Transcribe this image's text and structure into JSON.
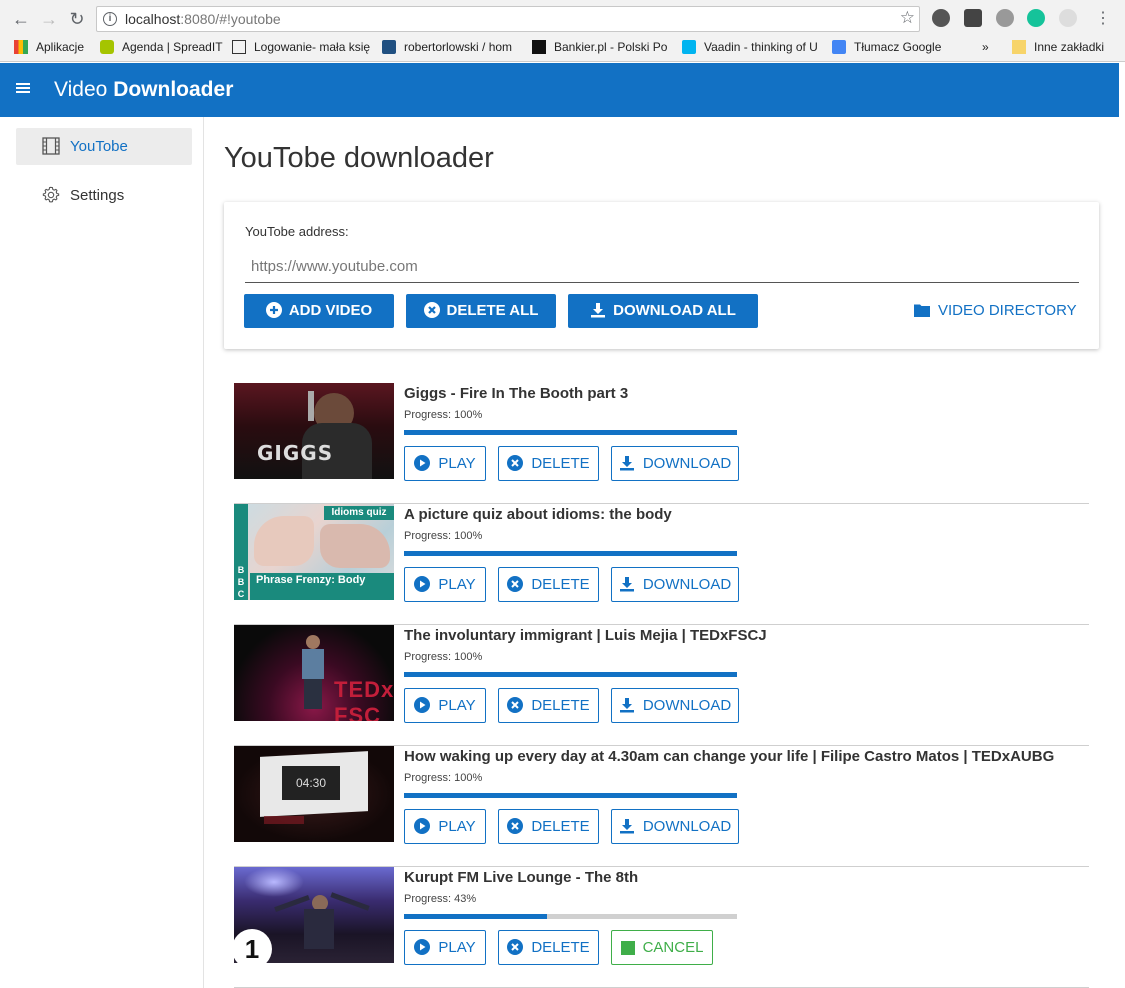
{
  "browser": {
    "url_host": "localhost",
    "url_path": ":8080/#!youtobe",
    "bookmarks": [
      {
        "label": "Aplikacje",
        "icon": "apps-grid-icon"
      },
      {
        "label": "Agenda | SpreadIT",
        "icon": "spreadit-icon"
      },
      {
        "label": "Logowanie- mała księ",
        "icon": "ifi-icon"
      },
      {
        "label": "robertorlowski / hom",
        "icon": "bitbucket-icon"
      },
      {
        "label": "Bankier.pl - Polski Po",
        "icon": "bankier-icon"
      },
      {
        "label": "Vaadin - thinking of U",
        "icon": "vaadin-icon"
      },
      {
        "label": "Tłumacz Google",
        "icon": "google-translate-icon"
      }
    ],
    "more_bookmarks": "»",
    "other_bookmarks": "Inne zakładki"
  },
  "app": {
    "title_light": "Video",
    "title_bold": "Downloader",
    "primary_color": "#1271c4"
  },
  "sidebar": {
    "items": [
      {
        "label": "YouTobe",
        "icon": "film-icon",
        "active": true
      },
      {
        "label": "Settings",
        "icon": "gear-icon",
        "active": false
      }
    ]
  },
  "main": {
    "title": "YouTobe downloader",
    "address_label": "YouTobe address:",
    "address_placeholder": "https://www.youtube.com",
    "add_video": "ADD VIDEO",
    "delete_all": "DELETE ALL",
    "download_all": "DOWNLOAD ALL",
    "video_directory": "VIDEO DIRECTORY"
  },
  "videos": [
    {
      "title": "Giggs - Fire In The Booth part 3",
      "progress_label": "Progress: 100%",
      "progress": 1.0,
      "play": "PLAY",
      "delete": "DELETE",
      "action": "DOWNLOAD",
      "action_type": "download",
      "thumb_text": "GIGGS"
    },
    {
      "title": "A picture quiz about idioms: the body",
      "progress_label": "Progress: 100%",
      "progress": 1.0,
      "play": "PLAY",
      "delete": "DELETE",
      "action": "DOWNLOAD",
      "action_type": "download",
      "thumb_text": "Phrase Frenzy: Body",
      "thumb_text2": "Idioms quiz",
      "thumb_text3": "BBC"
    },
    {
      "title": "The involuntary immigrant | Luis Mejia | TEDxFSCJ",
      "progress_label": "Progress: 100%",
      "progress": 1.0,
      "play": "PLAY",
      "delete": "DELETE",
      "action": "DOWNLOAD",
      "action_type": "download",
      "thumb_text": "TEDx FSC"
    },
    {
      "title": "How waking up every day at 4.30am can change your life | Filipe Castro Matos | TEDxAUBG",
      "progress_label": "Progress: 100%",
      "progress": 1.0,
      "play": "PLAY",
      "delete": "DELETE",
      "action": "DOWNLOAD",
      "action_type": "download",
      "thumb_text": "04:30"
    },
    {
      "title": "Kurupt FM Live Lounge - The 8th",
      "progress_label": "Progress: 43%",
      "progress": 0.43,
      "play": "PLAY",
      "delete": "DELETE",
      "action": "CANCEL",
      "action_type": "cancel",
      "thumb_text": "1"
    }
  ]
}
